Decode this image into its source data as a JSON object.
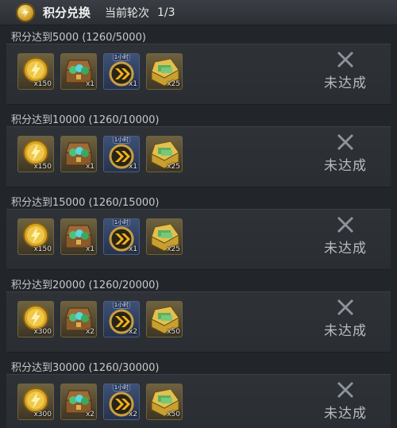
{
  "header": {
    "title": "积分兑换",
    "round_label": "当前轮次",
    "round_value": "1/3",
    "icon": "points-coin-icon"
  },
  "tiers": [
    {
      "condition": "积分达到5000 (1260/5000)",
      "status": "未达成",
      "rewards": [
        {
          "icon": "gold-coin-icon",
          "qty": "x150"
        },
        {
          "icon": "gem-chest-icon",
          "qty": "x1"
        },
        {
          "icon": "speedup-1h-icon",
          "qty": "x1",
          "tag": "1小时"
        },
        {
          "icon": "cash-crate-icon",
          "qty": "x25"
        }
      ]
    },
    {
      "condition": "积分达到10000 (1260/10000)",
      "status": "未达成",
      "rewards": [
        {
          "icon": "gold-coin-icon",
          "qty": "x150"
        },
        {
          "icon": "gem-chest-icon",
          "qty": "x1"
        },
        {
          "icon": "speedup-1h-icon",
          "qty": "x1",
          "tag": "1小时"
        },
        {
          "icon": "cash-crate-icon",
          "qty": "x25"
        }
      ]
    },
    {
      "condition": "积分达到15000 (1260/15000)",
      "status": "未达成",
      "rewards": [
        {
          "icon": "gold-coin-icon",
          "qty": "x150"
        },
        {
          "icon": "gem-chest-icon",
          "qty": "x1"
        },
        {
          "icon": "speedup-1h-icon",
          "qty": "x1",
          "tag": "1小时"
        },
        {
          "icon": "cash-crate-icon",
          "qty": "x25"
        }
      ]
    },
    {
      "condition": "积分达到20000 (1260/20000)",
      "status": "未达成",
      "rewards": [
        {
          "icon": "gold-coin-icon",
          "qty": "x300"
        },
        {
          "icon": "gem-chest-icon",
          "qty": "x2"
        },
        {
          "icon": "speedup-1h-icon",
          "qty": "x2",
          "tag": "1小时"
        },
        {
          "icon": "cash-crate-icon",
          "qty": "x50"
        }
      ]
    },
    {
      "condition": "积分达到30000 (1260/30000)",
      "status": "未达成",
      "rewards": [
        {
          "icon": "gold-coin-icon",
          "qty": "x300"
        },
        {
          "icon": "gem-chest-icon",
          "qty": "x2"
        },
        {
          "icon": "speedup-1h-icon",
          "qty": "x2",
          "tag": "1小时"
        },
        {
          "icon": "cash-crate-icon",
          "qty": "x50"
        }
      ]
    }
  ]
}
